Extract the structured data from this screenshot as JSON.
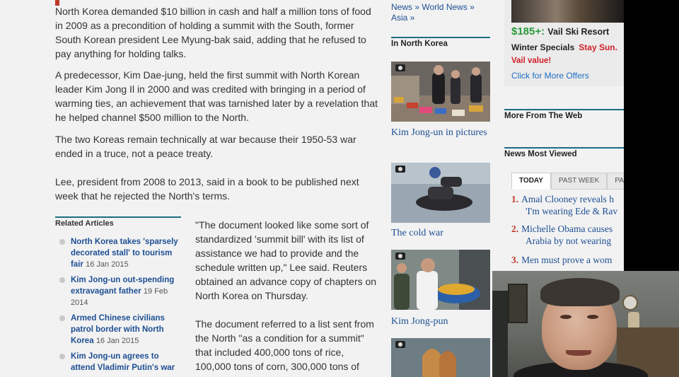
{
  "article": {
    "p1": "North Korea demanded $10 billion in cash and half a million tons of food in 2009 as a precondition of holding a summit with the South, former South Korean president Lee Myung-bak said, adding that he refused to pay anything for holding talks.",
    "p2": "A predecessor, Kim Dae-jung, held the first summit with North Korean leader Kim Jong Il in 2000 and was credited with bringing in a period of warming ties, an achievement that was tarnished later by a revelation that he helped channel $500 million to the North.",
    "p3": "The two Koreas remain technically at war because their 1950-53 war ended in a truce, not a peace treaty.",
    "p4": "Lee, president from 2008 to 2013, said in a book to be published next week that he rejected the North's terms.",
    "quote_p1": "\"The document looked like some sort of standardized 'summit bill' with its list of assistance we had to provide and the schedule written up,\" Lee said. Reuters obtained an advance copy of chapters on North Korea on Thursday.",
    "quote_p2": "The document referred to a list sent from the North \"as a condition for a summit\" that included 400,000 tons of rice, 100,000 tons of corn, 300,000 tons of"
  },
  "related": {
    "heading": "Related Articles",
    "items": [
      {
        "title": "North Korea takes 'sparsely decorated stall' to tourism fair",
        "date": "16 Jan 2015"
      },
      {
        "title": "Kim Jong-un out-spending extravagant father",
        "date": "19 Feb 2014"
      },
      {
        "title": "Armed Chinese civilians patrol border with North Korea",
        "date": "16 Jan 2015"
      },
      {
        "title": "Kim Jong-un agrees to attend Vladimir Putin's war",
        "date": ""
      }
    ]
  },
  "middle": {
    "breadcrumbs": [
      "News »",
      "World News »",
      "Asia »"
    ],
    "section_title": "In North Korea",
    "captions": [
      "Kim Jong-un in pictures",
      "The cold war",
      "Kim Jong-pun"
    ],
    "icon": "camera-icon"
  },
  "sidebar": {
    "ad": {
      "price": "$185+:",
      "resort": "Vail Ski Resort",
      "line2": "Winter Specials",
      "line2_red": "Stay Sun.",
      "value": "Vail value!",
      "more": "Click for More Offers"
    },
    "more_from_web": "More From The Web",
    "most_viewed": {
      "heading": "News Most Viewed",
      "tabs": [
        "TODAY",
        "PAST WEEK",
        "PAST"
      ],
      "items": [
        {
          "num": "1.",
          "l1": "Amal Clooney reveals h",
          "l2": "'I'm wearing Ede & Rav"
        },
        {
          "num": "2.",
          "l1": "Michelle Obama causes",
          "l2": "Arabia by not wearing"
        },
        {
          "num": "3.",
          "l1": "Men must prove a wom",
          "l2": ""
        }
      ]
    }
  },
  "colors": {
    "accent": "#1e6d82",
    "link": "#1e4f94",
    "red": "#c0392b",
    "green": "#2a9a3a"
  }
}
